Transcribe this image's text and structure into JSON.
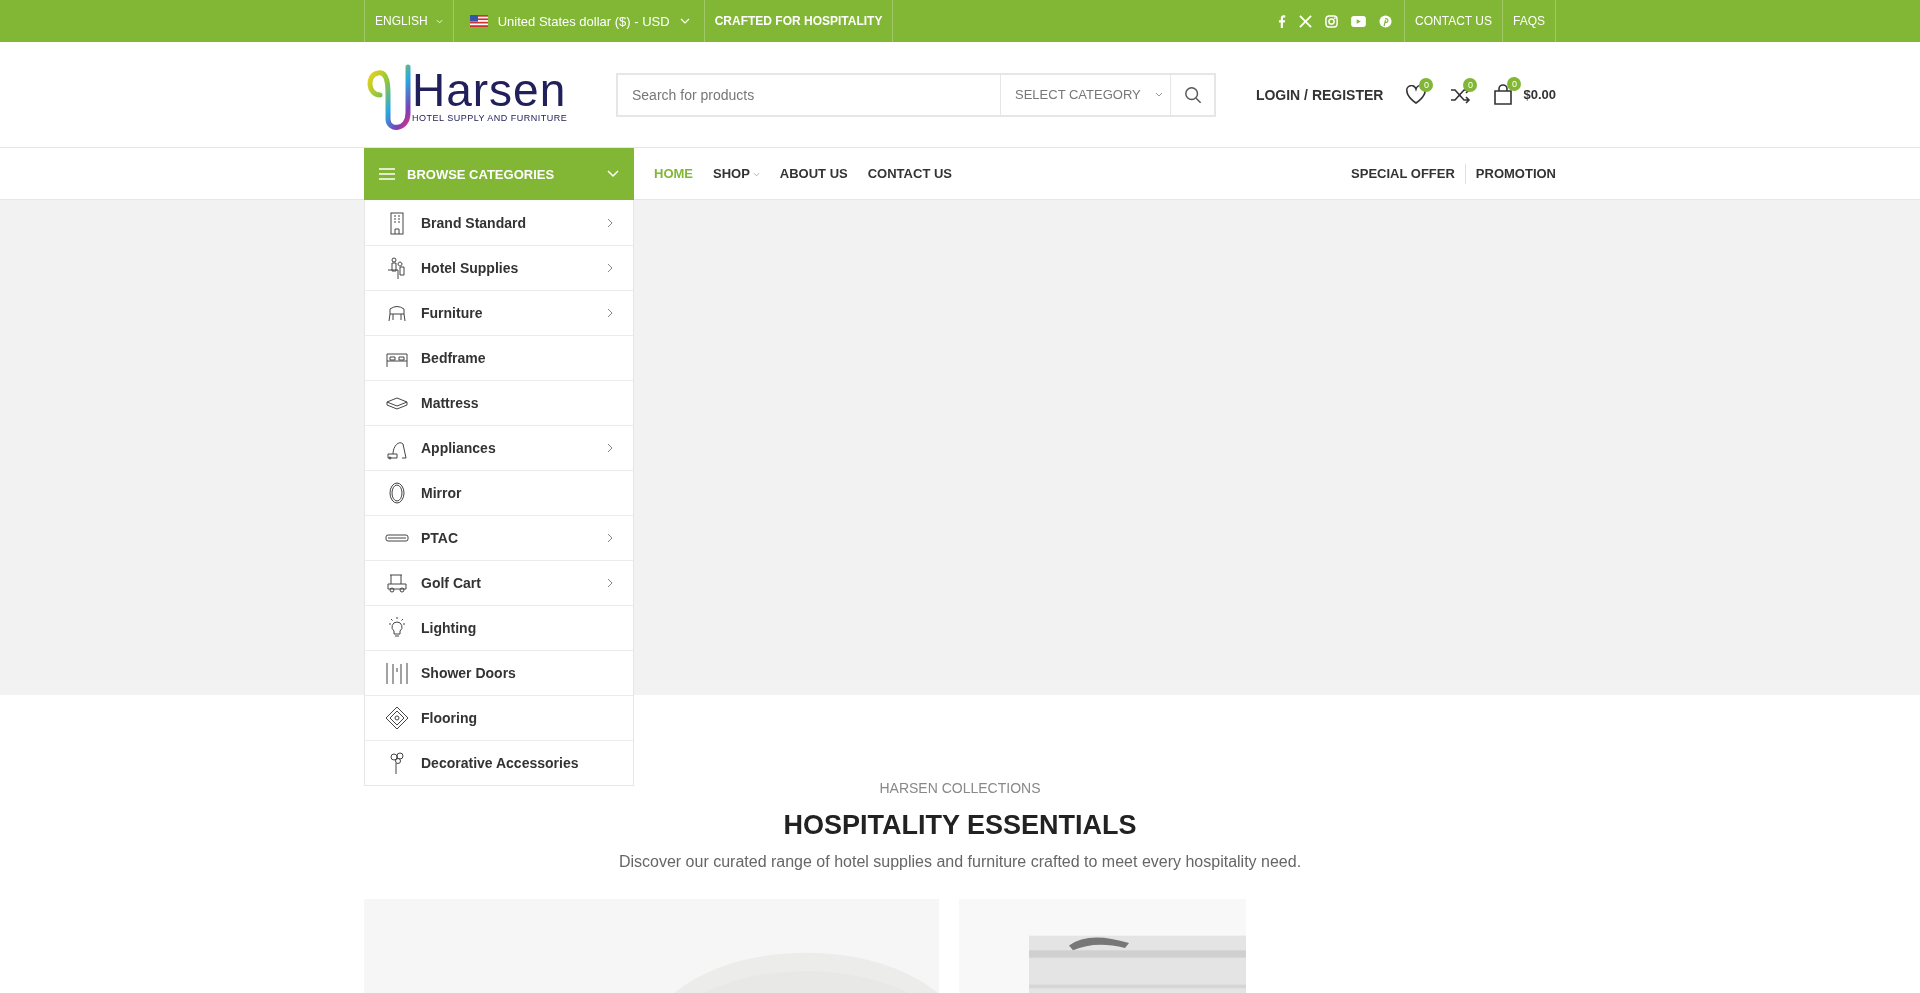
{
  "top_bar": {
    "language": "ENGLISH",
    "currency": "United States dollar ($) - USD",
    "tagline": "CRAFTED FOR HOSPITALITY",
    "links": [
      "CONTACT US",
      "FAQS"
    ]
  },
  "header": {
    "logo": {
      "name": "Harsen",
      "tagline": "HOTEL SUPPLY AND FURNITURE"
    },
    "search": {
      "placeholder": "Search for products",
      "category": "SELECT CATEGORY"
    },
    "account": "LOGIN / REGISTER",
    "wishlist_count": "0",
    "compare_count": "0",
    "cart_count": "0",
    "cart_total": "$0.00"
  },
  "nav": {
    "browse": "BROWSE CATEGORIES",
    "items": [
      {
        "label": "HOME",
        "selected": true,
        "has_dropdown": false
      },
      {
        "label": "SHOP",
        "selected": false,
        "has_dropdown": true
      },
      {
        "label": "ABOUT US",
        "selected": false,
        "has_dropdown": false
      },
      {
        "label": "CONTACT US",
        "selected": false,
        "has_dropdown": false
      }
    ],
    "right_links": [
      "SPECIAL OFFER",
      "PROMOTION"
    ]
  },
  "categories": [
    {
      "label": "Brand Standard",
      "has_submenu": true
    },
    {
      "label": "Hotel Supplies",
      "has_submenu": true
    },
    {
      "label": "Furniture",
      "has_submenu": true
    },
    {
      "label": "Bedframe",
      "has_submenu": false
    },
    {
      "label": "Mattress",
      "has_submenu": false
    },
    {
      "label": "Appliances",
      "has_submenu": true
    },
    {
      "label": "Mirror",
      "has_submenu": false
    },
    {
      "label": "PTAC",
      "has_submenu": true
    },
    {
      "label": "Golf Cart",
      "has_submenu": true
    },
    {
      "label": "Lighting",
      "has_submenu": false
    },
    {
      "label": "Shower Doors",
      "has_submenu": false
    },
    {
      "label": "Flooring",
      "has_submenu": false
    },
    {
      "label": "Decorative Accessories",
      "has_submenu": false
    }
  ],
  "section": {
    "eyebrow": "HARSEN COLLECTIONS",
    "title": "HOSPITALITY ESSENTIALS",
    "subtitle": "Discover our curated range of hotel supplies and furniture crafted to meet every hospitality need."
  }
}
